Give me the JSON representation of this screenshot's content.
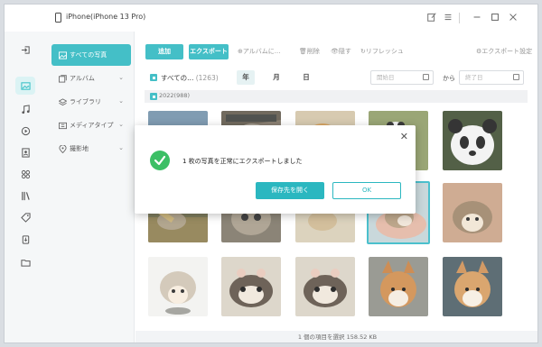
{
  "window": {
    "title": "iPhone(iPhone 13 Pro)"
  },
  "sidebar": {
    "items": [
      {
        "label": "すべての写真",
        "icon": "photo-icon",
        "active": true
      },
      {
        "label": "アルバム",
        "icon": "album-icon"
      },
      {
        "label": "ライブラリ",
        "icon": "layers-icon"
      },
      {
        "label": "メディアタイプ",
        "icon": "media-type-icon"
      },
      {
        "label": "撮影地",
        "icon": "location-icon"
      }
    ]
  },
  "toolbar": {
    "add_label": "追加",
    "export_label": "エクスポート",
    "add_to_album_label": "アルバムに...",
    "delete_label": "削除",
    "hide_label": "隠す",
    "refresh_label": "リフレッシュ",
    "export_settings_label": "エクスポート設定"
  },
  "filter": {
    "all_label": "すべての...",
    "count": "(1263)",
    "year_label": "年",
    "month_label": "月",
    "day_label": "日",
    "start_placeholder": "開始日",
    "separator": "から",
    "end_placeholder": "終了日"
  },
  "group": {
    "year_label": "2022(988)"
  },
  "photos": [
    {
      "subject": "squirrel-photo"
    },
    {
      "subject": "raccoon-photo"
    },
    {
      "subject": "hamster-photo"
    },
    {
      "subject": "panda-in-grass-photo"
    },
    {
      "subject": "panda-face-photo"
    },
    {
      "subject": "cat-on-log-photo"
    },
    {
      "subject": "kitten-photo"
    },
    {
      "subject": "hamster-sand-photo"
    },
    {
      "subject": "hedgehog-in-hands-photo"
    },
    {
      "subject": "hedgehog-photo"
    },
    {
      "subject": "hedgehog-white-photo"
    },
    {
      "subject": "cats-sleeping-photo"
    },
    {
      "subject": "cats-sleeping-2-photo"
    },
    {
      "subject": "shiba-inu-photo"
    },
    {
      "subject": "shiba-inu-2-photo"
    }
  ],
  "status": {
    "text": "1 個の項目を選択 158.52 KB"
  },
  "dialog": {
    "message": "1 枚の写真を正常にエクスポートしました",
    "open_folder_label": "保存先を開く",
    "ok_label": "OK"
  },
  "colors": {
    "accent": "#2bb7c0",
    "success": "#3cbf65"
  }
}
